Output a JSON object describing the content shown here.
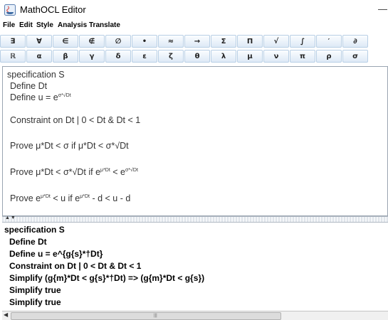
{
  "window": {
    "title": "MathOCL Editor",
    "minimize": "—"
  },
  "menu": [
    "File",
    "Edit",
    "Style",
    "Analysis",
    "Translate"
  ],
  "symbols": {
    "row1": [
      "∃",
      "∀",
      "∈",
      "∉",
      "∅",
      "•",
      "≈",
      "→",
      "Σ",
      "Π",
      "√",
      "∫",
      "′",
      "∂"
    ],
    "row2": [
      "ℝ",
      "α",
      "β",
      "γ",
      "δ",
      "ε",
      "ζ",
      "θ",
      "λ",
      "μ",
      "ν",
      "π",
      "ρ",
      "σ"
    ]
  },
  "top_editor": {
    "l1": "specification S",
    "l2": "Define Dt",
    "l3a": "Define u = e",
    "l3sup": "σ*√Dt",
    "l4": "Constraint on Dt | 0 < Dt & Dt < 1",
    "l5": "Prove μ*Dt < σ if μ*Dt < σ*√Dt",
    "l6a": "Prove μ*Dt < σ*√Dt if e",
    "l6sup1": "μ*Dt",
    "l6b": " < e",
    "l6sup2": "σ*√Dt",
    "l7a": "Prove e",
    "l7sup1": "μ*Dt",
    "l7b": " < u if e",
    "l7sup2": "μ*Dt",
    "l7c": " - d < u - d"
  },
  "bottom_editor": [
    "specification S",
    "Define Dt",
    "Define u = e^{g{s}*†Dt}",
    "Constraint on Dt | 0 < Dt & Dt < 1",
    "Simplify (g{m}*Dt < g{s}*†Dt) => (g{m}*Dt < g{s})",
    "Simplify true",
    "Simplify true"
  ],
  "splitter": {
    "arrows": "▲▼"
  },
  "scrollbar": {
    "left_arrow": "◀",
    "grip": "|||"
  },
  "colors": {
    "button_border": "#b8cfe5",
    "button_top": "#fbfdff",
    "button_bottom": "#dde9f6"
  }
}
